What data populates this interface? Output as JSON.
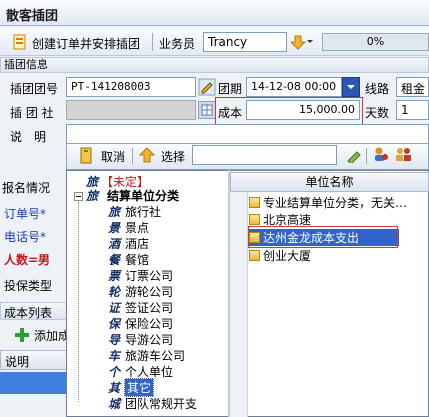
{
  "window": {
    "title": "散客插团"
  },
  "toolbar": {
    "create_label": "创建订单并安排插团",
    "salesman_label": "业务员",
    "salesman_value": "Trancy",
    "progress": "0%"
  },
  "section": {
    "group_info": "插团信息"
  },
  "form": {
    "group_no_label": "插团团号",
    "group_no_value": "PT-141208003",
    "date_label": "团期",
    "date_value": "14-12-08 00:00",
    "route_label": "线路",
    "route_value": "租金",
    "agency_label": "插 团 社",
    "cost_label": "成本",
    "cost_value": "15,000.00",
    "days_label": "天数",
    "days_value": "1",
    "desc_label": "说　明"
  },
  "subtoolbar": {
    "cancel_label": "取消",
    "select_label": "选择"
  },
  "left": {
    "signup_label": "报名情况",
    "order_label": "订单号*",
    "phone_label": "电话号*",
    "people_label": "人数=男",
    "insurance_label": "投保类型",
    "cost_list_label": "成本列表",
    "add_label": "添加成",
    "desc_col": "说明"
  },
  "tree": {
    "unsettled": "【未定】",
    "root": "结算单位分类",
    "items": [
      "旅行社",
      "景点",
      "酒店",
      "餐馆",
      "订票公司",
      "游轮公司",
      "签证公司",
      "保险公司",
      "导游公司",
      "旅游车公司",
      "个人单位",
      "其它",
      "团队常规开支"
    ],
    "calligraphy": [
      "旅",
      "旅",
      "旅",
      "景",
      "酒",
      "餐",
      "票",
      "轮",
      "证",
      "保",
      "导",
      "车",
      "个",
      "其",
      "城"
    ]
  },
  "list": {
    "header": "单位名称",
    "rows": [
      "专业结算单位分类，无关…",
      "北京高速",
      "达州金龙成本支出",
      "创业大厦"
    ]
  }
}
